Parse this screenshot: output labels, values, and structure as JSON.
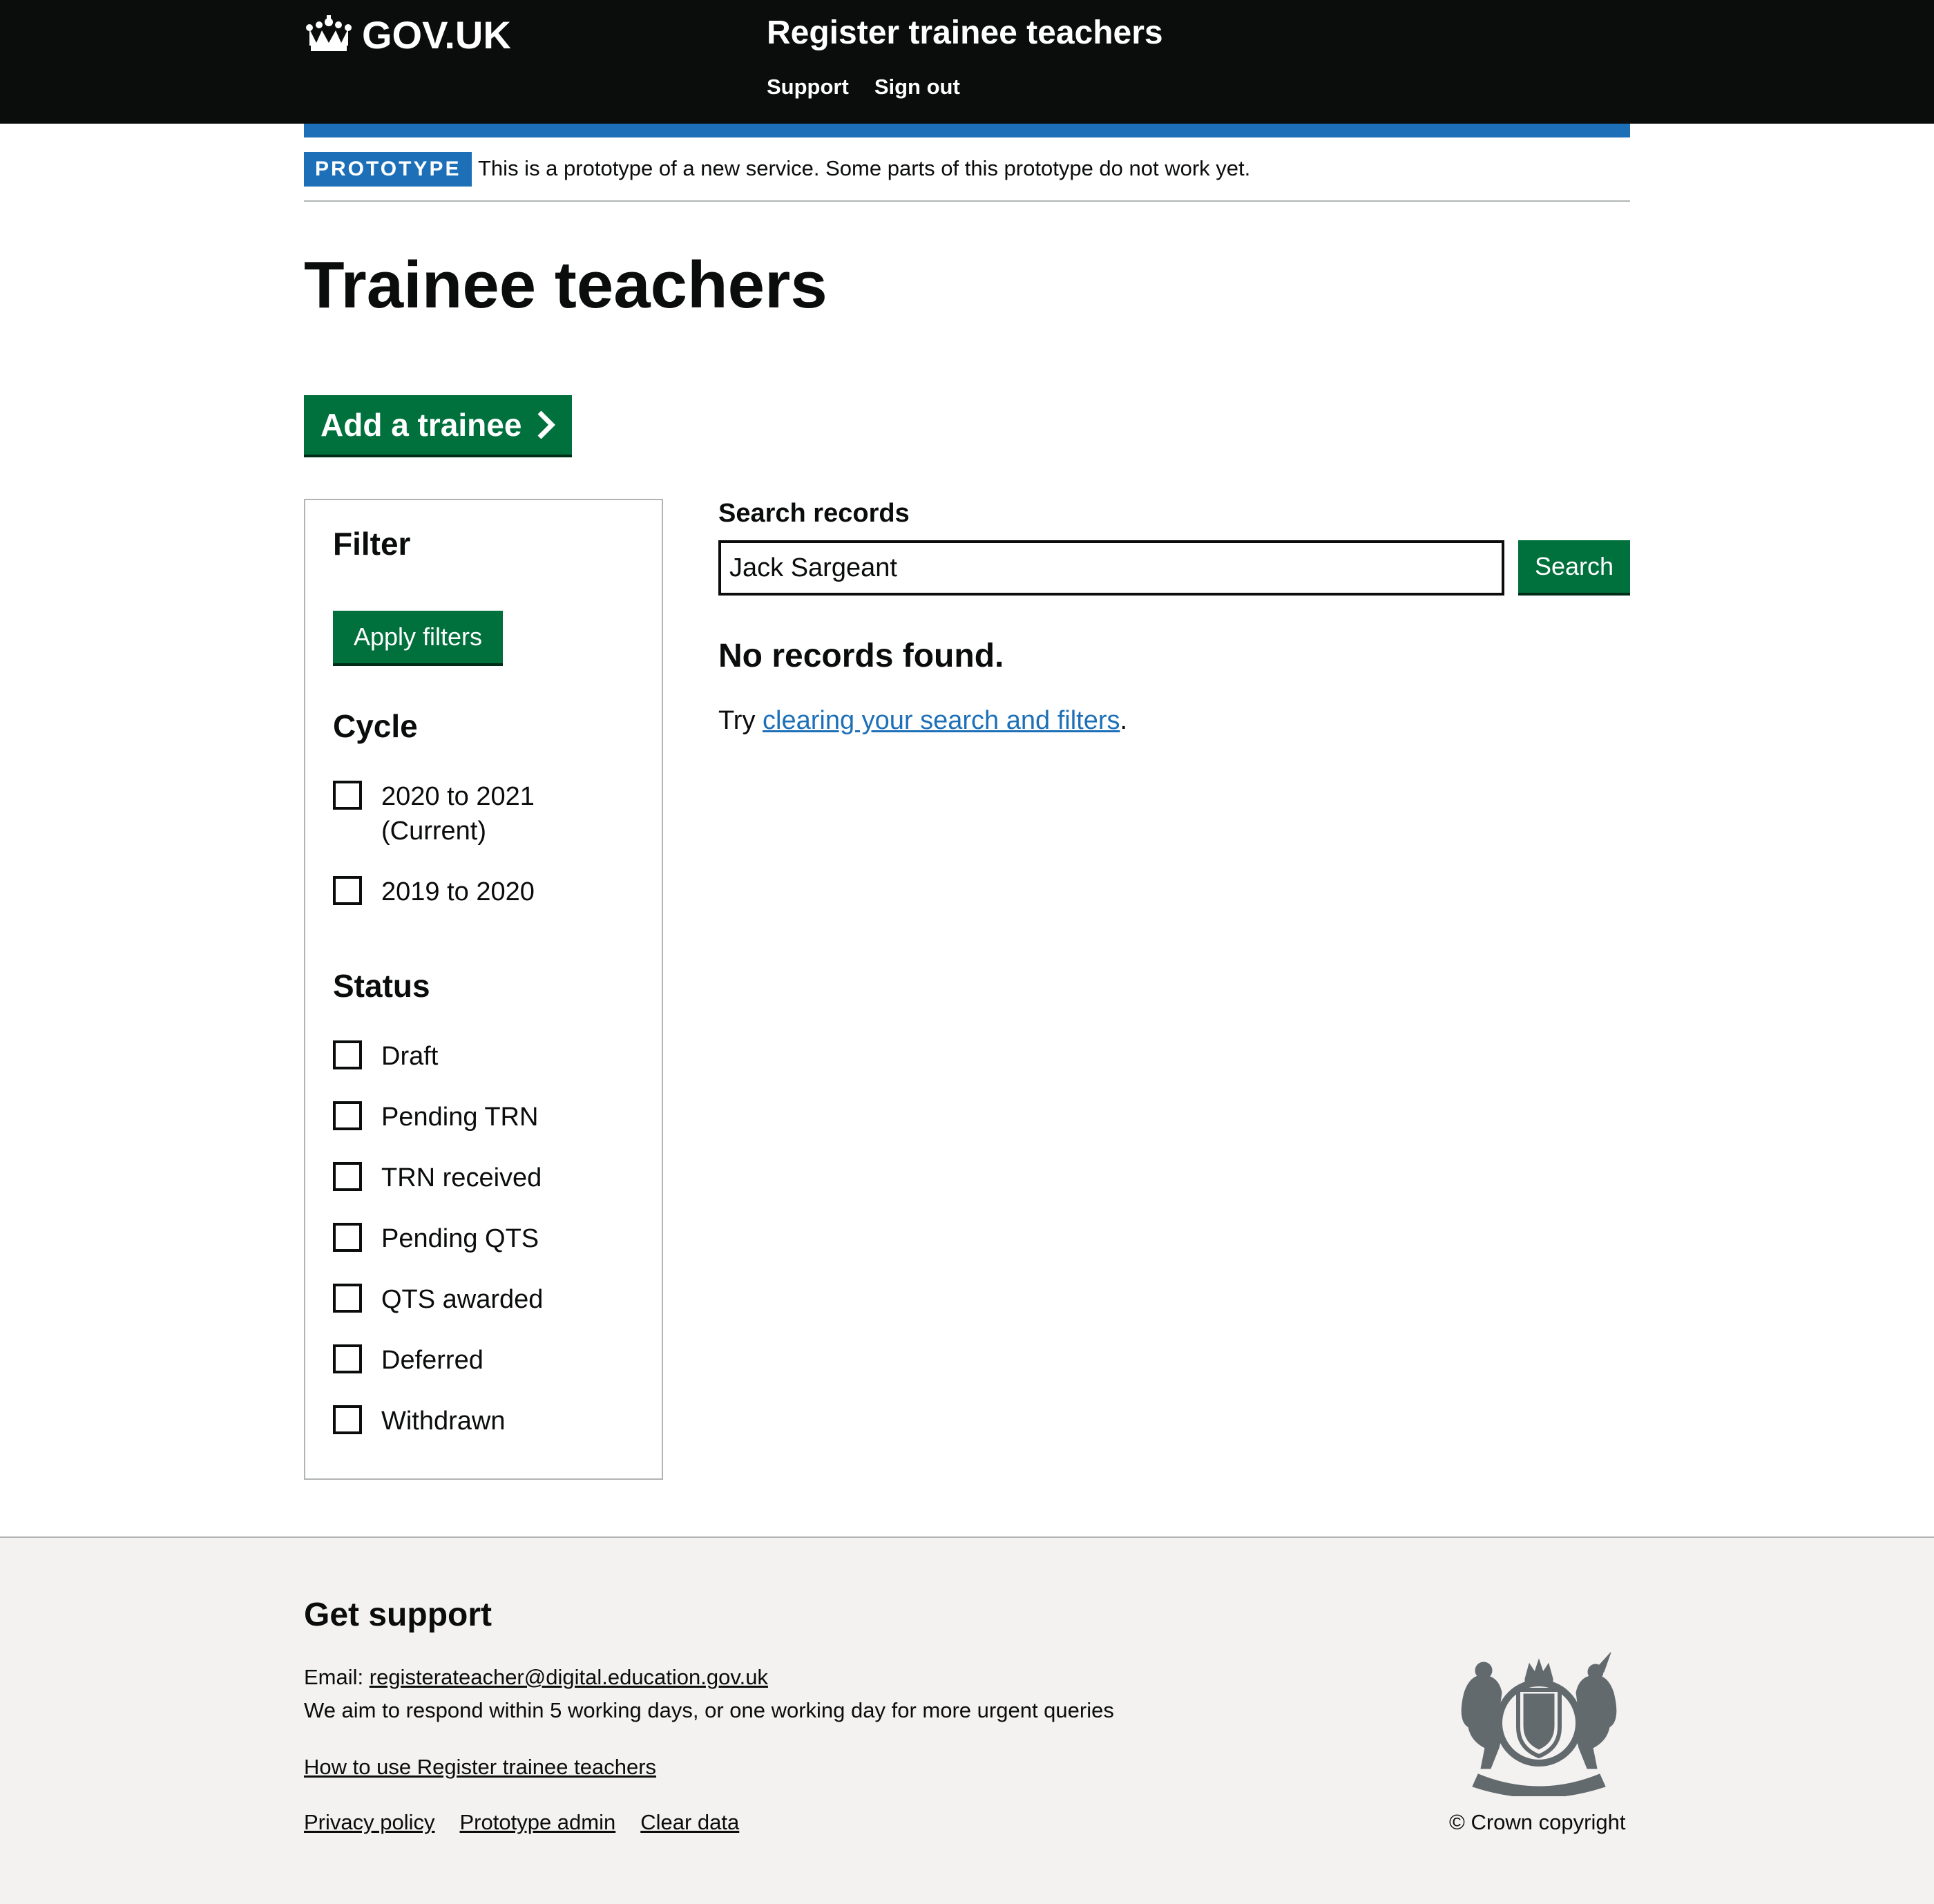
{
  "header": {
    "logo_text": "GOV.UK",
    "service_name": "Register trainee teachers",
    "nav": [
      "Support",
      "Sign out"
    ]
  },
  "phase_banner": {
    "tag": "PROTOTYPE",
    "text": "This is a prototype of a new service. Some parts of this prototype do not work yet."
  },
  "page_title": "Trainee teachers",
  "add_button_label": "Add a trainee",
  "filter": {
    "title": "Filter",
    "apply_label": "Apply filters",
    "cycle": {
      "title": "Cycle",
      "options": [
        {
          "label": "2020 to 2021 (Current)",
          "checked": false
        },
        {
          "label": "2019 to 2020",
          "checked": false
        }
      ]
    },
    "status": {
      "title": "Status",
      "options": [
        {
          "label": "Draft",
          "checked": false
        },
        {
          "label": "Pending TRN",
          "checked": false
        },
        {
          "label": "TRN received",
          "checked": false
        },
        {
          "label": "Pending QTS",
          "checked": false
        },
        {
          "label": "QTS awarded",
          "checked": false
        },
        {
          "label": "Deferred",
          "checked": false
        },
        {
          "label": "Withdrawn",
          "checked": false
        }
      ]
    }
  },
  "search": {
    "label": "Search records",
    "value": "Jack Sargeant",
    "button_label": "Search"
  },
  "results": {
    "message": "No records found.",
    "try_prefix": "Try ",
    "try_link": "clearing your search and filters",
    "try_suffix": "."
  },
  "footer": {
    "heading": "Get support",
    "email_prefix": "Email: ",
    "email": "registerateacher@digital.education.gov.uk",
    "aim_text": "We aim to respond within 5 working days, or one working day for more urgent queries",
    "how_to_link": "How to use Register trainee teachers",
    "meta_links": [
      "Privacy policy",
      "Prototype admin",
      "Clear data"
    ],
    "copyright": "© Crown copyright"
  },
  "colors": {
    "header_bg": "#0b0c0c",
    "brand_blue": "#1d70b8",
    "button_green": "#00703c",
    "footer_bg": "#f3f2f1"
  },
  "icons": [
    "crown-icon",
    "chevron-right-icon",
    "royal-coat-of-arms-icon"
  ]
}
